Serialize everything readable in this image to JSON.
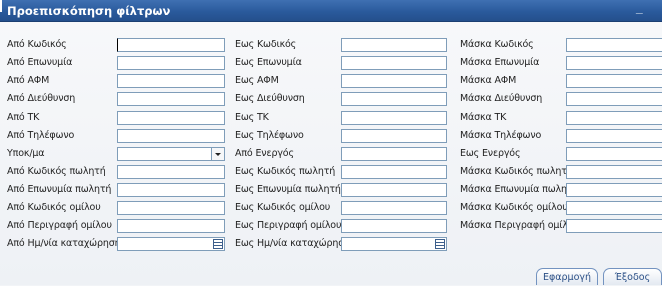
{
  "window": {
    "title": "Προεπισκόπηση φίλτρων",
    "minimize_glyph": "_"
  },
  "rows": [
    {
      "from": "Από Κωδικός",
      "to": "Εως Κωδικός",
      "mask": "Μάσκα Κωδικός"
    },
    {
      "from": "Από Επωνυμία",
      "to": "Εως Επωνυμία",
      "mask": "Μάσκα Επωνυμία"
    },
    {
      "from": "Από ΑΦΜ",
      "to": "Εως ΑΦΜ",
      "mask": "Μάσκα ΑΦΜ"
    },
    {
      "from": "Από Διεύθυνση",
      "to": "Εως Διεύθυνση",
      "mask": "Μάσκα Διεύθυνση"
    },
    {
      "from": "Από ΤΚ",
      "to": "Εως ΤΚ",
      "mask": "Μάσκα ΤΚ"
    },
    {
      "from": "Από Τηλέφωνο",
      "to": "Εως Τηλέφωνο",
      "mask": "Μάσκα Τηλέφωνο"
    },
    {
      "from": "Υποκ/μα",
      "to": "Από Ενεργός",
      "mask": "Εως Ενεργός"
    },
    {
      "from": "Από Κωδικός πωλητή",
      "to": "Εως Κωδικός πωλητή",
      "mask": "Μάσκα Κωδικός πωλητή"
    },
    {
      "from": "Από Επωνυμία πωλητή",
      "to": "Εως Επωνυμία πωλητή",
      "mask": "Μάσκα Επωνυμία πωλητή"
    },
    {
      "from": "Από Κωδικός ομίλου",
      "to": "Εως Κωδικός ομίλου",
      "mask": "Μάσκα Κωδικός ομίλου"
    },
    {
      "from": "Από Περιγραφή ομίλου",
      "to": "Εως Περιγραφή ομίλου",
      "mask": "Μάσκα Περιγραφή ομίλου"
    },
    {
      "from": "Από Ημ/νία καταχώρηση",
      "to": "Εως Ημ/νία καταχώρηση",
      "mask": ""
    }
  ],
  "buttons": {
    "apply": "Εφαρμογή",
    "exit": "Έξοδος"
  },
  "colors": {
    "titlebar": "#2a5a9c",
    "field_border": "#7f9db9",
    "button_text": "#2a4f86"
  }
}
